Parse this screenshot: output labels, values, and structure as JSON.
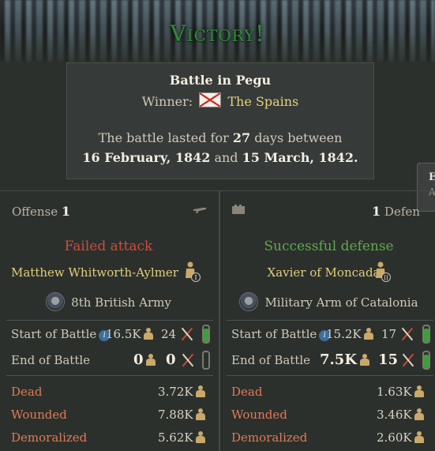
{
  "title": "Victory!",
  "summary": {
    "battle_name": "Battle in Pegu",
    "winner_label": "Winner:",
    "winner_name": "The Spains",
    "lasted_prefix": "The battle lasted for",
    "days": "27",
    "lasted_mid": "days between",
    "start_date": "16 February, 1842",
    "and_word": "and",
    "end_date": "15 March, 1842."
  },
  "side_tab": {
    "letter": "E",
    "sub": "A"
  },
  "offense": {
    "label": "Offense",
    "count": "1",
    "result": "Failed attack",
    "commander": "Matthew Whitworth-Aylmer",
    "commander_rank": "I",
    "army": "8th British Army",
    "start_label": "Start of Battle",
    "start_men": "16.5K",
    "start_regiments": "24",
    "start_morale": 0.85,
    "end_label": "End of Battle",
    "end_men": "0",
    "end_regiments": "0",
    "end_morale": 0.0,
    "dead_label": "Dead",
    "dead": "3.72K",
    "wounded_label": "Wounded",
    "wounded": "7.88K",
    "demoralized_label": "Demoralized",
    "demoralized": "5.62K"
  },
  "defense": {
    "label": "Defen",
    "count": "1",
    "result": "Successful defense",
    "commander": "Xavier of Moncada",
    "commander_rank": "II",
    "army": "Military Arm of Catalonia",
    "start_label": "Start of Battle",
    "start_men": "15.2K",
    "start_regiments": "17",
    "start_morale": 0.85,
    "end_label": "End of Battle",
    "end_men": "7.5K",
    "end_regiments": "15",
    "end_morale": 0.85,
    "dead_label": "Dead",
    "dead": "1.63K",
    "wounded_label": "Wounded",
    "wounded": "3.46K",
    "demoralized_label": "Demoralized",
    "demoralized": "2.60K"
  },
  "colors": {
    "victory": "#2f8a3c",
    "fail": "#d14a3a",
    "success": "#5ea94a",
    "commander": "#e0cf7a",
    "casualty_label": "#e07a55",
    "morale": "#3aa03a"
  }
}
